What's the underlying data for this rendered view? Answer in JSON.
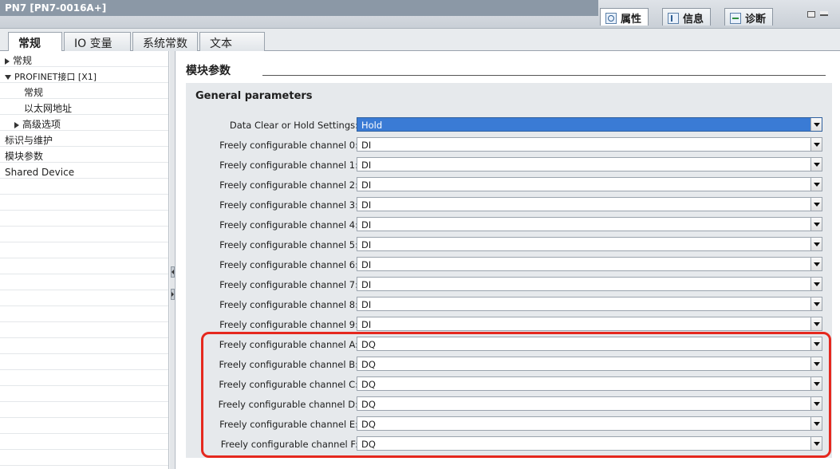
{
  "window": {
    "title": "PN7 [PN7-0016A+]",
    "inspector_tabs": [
      {
        "label": "属性",
        "icon": "properties-icon"
      },
      {
        "label": "信息",
        "icon": "info-icon"
      },
      {
        "label": "诊断",
        "icon": "diagnostics-icon"
      }
    ]
  },
  "tabs": [
    "常规",
    "IO 变量",
    "系统常数",
    "文本"
  ],
  "nav": {
    "items": [
      {
        "label": "常规",
        "level": 0,
        "expander": "collapsed"
      },
      {
        "label": "PROFINET接口 [X1]",
        "level": 0,
        "expander": "expanded"
      },
      {
        "label": "常规",
        "level": 2,
        "expander": "none"
      },
      {
        "label": "以太网地址",
        "level": 2,
        "expander": "none"
      },
      {
        "label": "高级选项",
        "level": 1,
        "expander": "collapsed"
      },
      {
        "label": "标识与维护",
        "level": 0,
        "expander": "none"
      },
      {
        "label": "模块参数",
        "level": 0,
        "expander": "none",
        "selected": true
      },
      {
        "label": "Shared Device",
        "level": 0,
        "expander": "none"
      }
    ]
  },
  "main": {
    "section_title": "模块参数",
    "group_title": "General parameters",
    "rows": [
      {
        "label": "Data Clear or Hold Settings:",
        "value": "Hold",
        "highlighted": true
      },
      {
        "label": "Freely configurable channel 0:",
        "value": "DI"
      },
      {
        "label": "Freely configurable channel 1:",
        "value": "DI"
      },
      {
        "label": "Freely configurable channel 2:",
        "value": "DI"
      },
      {
        "label": "Freely configurable channel 3:",
        "value": "DI"
      },
      {
        "label": "Freely configurable channel 4:",
        "value": "DI"
      },
      {
        "label": "Freely configurable channel 5:",
        "value": "DI"
      },
      {
        "label": "Freely configurable channel 6:",
        "value": "DI"
      },
      {
        "label": "Freely configurable channel 7:",
        "value": "DI"
      },
      {
        "label": "Freely configurable channel 8:",
        "value": "DI"
      },
      {
        "label": "Freely configurable channel 9:",
        "value": "DI"
      },
      {
        "label": "Freely configurable channel A:",
        "value": "DQ"
      },
      {
        "label": "Freely configurable channel B:",
        "value": "DQ"
      },
      {
        "label": "Freely configurable channel C:",
        "value": "DQ"
      },
      {
        "label": "Freely configurable channel D:",
        "value": "DQ"
      },
      {
        "label": "Freely configurable channel E:",
        "value": "DQ"
      },
      {
        "label": "Freely configurable channel F:",
        "value": "DQ"
      }
    ]
  },
  "colors": {
    "highlight_select": "#3a7bd5",
    "annotation_box": "#e5281e"
  }
}
